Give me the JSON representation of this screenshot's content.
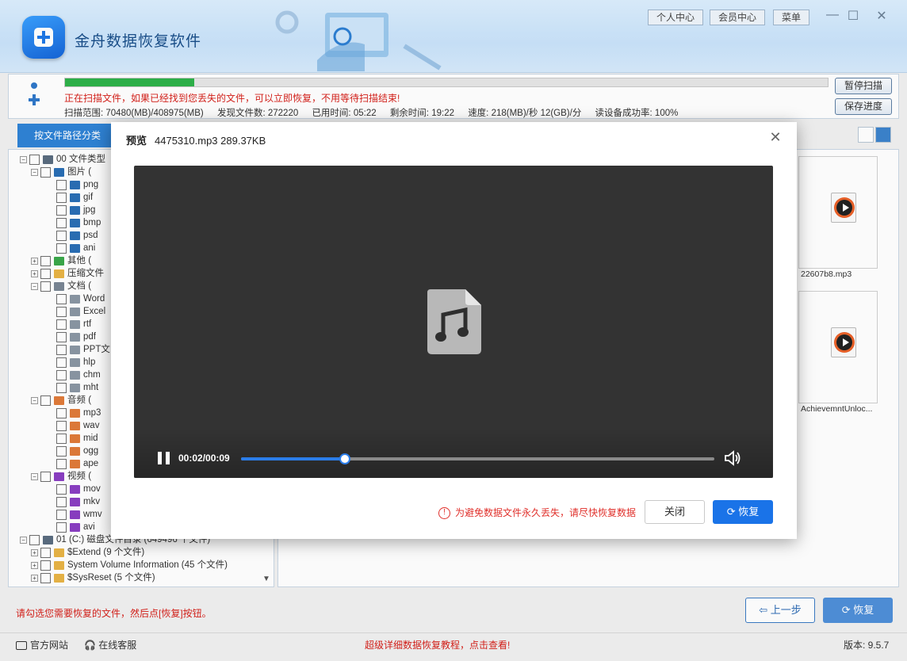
{
  "app": {
    "title": "金舟数据恢复软件"
  },
  "topbar": {
    "personal_center": "个人中心",
    "member_center": "会员中心",
    "menu": "菜单"
  },
  "scan": {
    "progress": 0.169,
    "message": "正在扫描文件，如果已经找到您丢失的文件，可以立即恢复，不用等待扫描结束!",
    "range": "扫描范围: 70480(MB)/408975(MB)",
    "found": "发现文件数: 272220",
    "elapsed": "已用时间: 05:22",
    "remaining": "剩余时间: 19:22",
    "speed": "速度: 218(MB)/秒  12(GB)/分",
    "success": "读设备成功率: 100%",
    "pause_btn": "暂停扫描",
    "save_btn": "保存进度"
  },
  "tab": {
    "label": "按文件路径分类"
  },
  "tree": [
    {
      "label": "00 文件类型",
      "level": 0,
      "exp": "−",
      "icon": "drive-icon",
      "color": "#5a6d80"
    },
    {
      "label": "图片  (",
      "level": 1,
      "exp": "−",
      "icon": "image-icon",
      "color": "#2a6fb5"
    },
    {
      "label": "png",
      "level": 2,
      "icon": "image-icon",
      "color": "#2a6fb5"
    },
    {
      "label": "gif",
      "level": 2,
      "icon": "image-icon",
      "color": "#2a6fb5"
    },
    {
      "label": "jpg",
      "level": 2,
      "icon": "image-icon",
      "color": "#2a6fb5"
    },
    {
      "label": "bmp",
      "level": 2,
      "icon": "image-icon",
      "color": "#2a6fb5"
    },
    {
      "label": "psd",
      "level": 2,
      "icon": "image-icon",
      "color": "#2a6fb5"
    },
    {
      "label": "ani",
      "level": 2,
      "icon": "image-icon",
      "color": "#2a6fb5"
    },
    {
      "label": "其他  (",
      "level": 1,
      "exp": "+",
      "icon": "folder-icon",
      "color": "#3aa84a"
    },
    {
      "label": "压缩文件",
      "level": 1,
      "exp": "+",
      "icon": "folder-icon",
      "color": "#e8b446"
    },
    {
      "label": "文档  (",
      "level": 1,
      "exp": "−",
      "icon": "document-icon",
      "color": "#7a8694"
    },
    {
      "label": "Word",
      "level": 2,
      "icon": "document-icon",
      "color": "#8a96a4"
    },
    {
      "label": "Excel",
      "level": 2,
      "icon": "document-icon",
      "color": "#8a96a4"
    },
    {
      "label": "rtf",
      "level": 2,
      "icon": "document-icon",
      "color": "#8a96a4"
    },
    {
      "label": "pdf",
      "level": 2,
      "icon": "document-icon",
      "color": "#8a96a4"
    },
    {
      "label": "PPT文",
      "level": 2,
      "icon": "document-icon",
      "color": "#8a96a4"
    },
    {
      "label": "hlp",
      "level": 2,
      "icon": "document-icon",
      "color": "#8a96a4"
    },
    {
      "label": "chm",
      "level": 2,
      "icon": "document-icon",
      "color": "#8a96a4"
    },
    {
      "label": "mht",
      "level": 2,
      "icon": "document-icon",
      "color": "#8a96a4"
    },
    {
      "label": "音频  (",
      "level": 1,
      "exp": "−",
      "icon": "audio-icon",
      "color": "#e07b3a"
    },
    {
      "label": "mp3",
      "level": 2,
      "icon": "audio-icon",
      "color": "#e07b3a"
    },
    {
      "label": "wav",
      "level": 2,
      "icon": "audio-icon",
      "color": "#e07b3a"
    },
    {
      "label": "mid",
      "level": 2,
      "icon": "audio-icon",
      "color": "#e07b3a"
    },
    {
      "label": "ogg",
      "level": 2,
      "icon": "audio-icon",
      "color": "#e07b3a"
    },
    {
      "label": "ape",
      "level": 2,
      "icon": "audio-icon",
      "color": "#e07b3a"
    },
    {
      "label": "视频  (",
      "level": 1,
      "exp": "−",
      "icon": "video-icon",
      "color": "#8a3fc2"
    },
    {
      "label": "mov",
      "level": 2,
      "icon": "video-icon",
      "color": "#8a3fc2"
    },
    {
      "label": "mkv",
      "level": 2,
      "icon": "video-icon",
      "color": "#8a3fc2"
    },
    {
      "label": "wmv",
      "level": 2,
      "icon": "video-icon",
      "color": "#8a3fc2"
    },
    {
      "label": "avi",
      "level": 2,
      "icon": "video-icon",
      "color": "#8a3fc2"
    },
    {
      "label": "01 (C:) 磁盘文件目录  (649496 个文件)",
      "level": 0,
      "exp": "−",
      "icon": "drive-icon",
      "color": "#5a6d80"
    },
    {
      "label": "$Extend     (9 个文件)",
      "level": 1,
      "exp": "+",
      "icon": "folder-icon",
      "color": "#e8b446"
    },
    {
      "label": "System Volume Information     (45 个文件)",
      "level": 1,
      "exp": "+",
      "icon": "folder-icon",
      "color": "#e8b446"
    },
    {
      "label": "$SysReset     (5 个文件)",
      "level": 1,
      "exp": "+",
      "icon": "folder-icon",
      "color": "#e8b446"
    }
  ],
  "thumbs": [
    {
      "caption": "22607b8.mp3"
    },
    {
      "caption": "AchievemntUnloc..."
    }
  ],
  "bottom": {
    "hint": "请勾选您需要恢复的文件，然后点[恢复]按钮。",
    "prev": "上一步",
    "recover": "恢复"
  },
  "status": {
    "site": "官方网站",
    "service": "在线客服",
    "promo": "超级详细数据恢复教程，点击查看!",
    "version": "版本: 9.5.7"
  },
  "preview": {
    "title": "预览",
    "file": "4475310.mp3 289.37KB",
    "time": "00:02/00:09",
    "progress": 0.22,
    "warning": "为避免数据文件永久丢失，请尽快恢复数据",
    "close": "关闭",
    "recover": "恢复"
  },
  "colors": {
    "accent": "#1a73e8",
    "scan_progress": "#2eb24a",
    "warning": "#e0302b"
  }
}
